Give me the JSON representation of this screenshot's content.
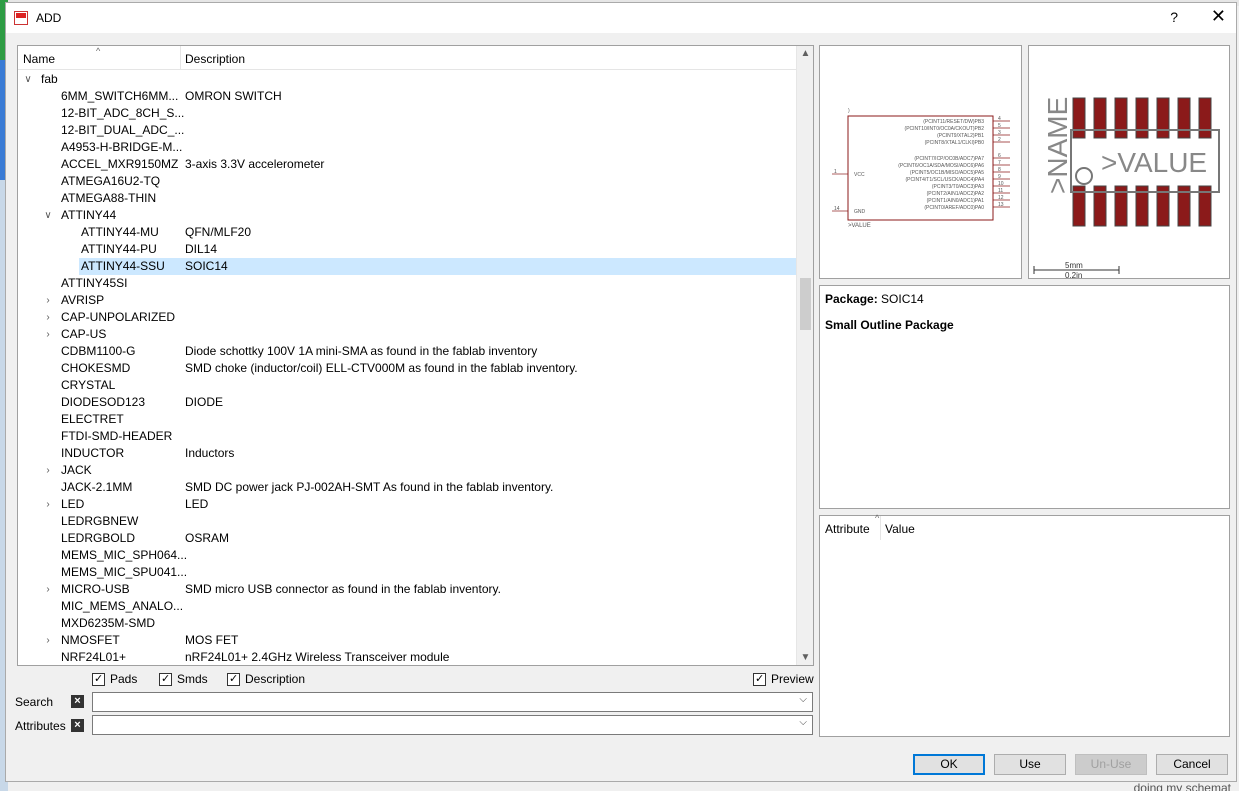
{
  "window": {
    "title": "ADD",
    "help": "?",
    "close": "✕"
  },
  "tree": {
    "col_name": "Name",
    "col_desc": "Description",
    "rows": [
      {
        "level": 0,
        "exp": "open",
        "name": "fab",
        "desc": ""
      },
      {
        "level": 1,
        "exp": "none",
        "name": "6MM_SWITCH6MM...",
        "desc": "OMRON SWITCH"
      },
      {
        "level": 1,
        "exp": "none",
        "name": "12-BIT_ADC_8CH_S...",
        "desc": ""
      },
      {
        "level": 1,
        "exp": "none",
        "name": "12-BIT_DUAL_ADC_...",
        "desc": ""
      },
      {
        "level": 1,
        "exp": "none",
        "name": "A4953-H-BRIDGE-M...",
        "desc": ""
      },
      {
        "level": 1,
        "exp": "none",
        "name": "ACCEL_MXR9150MZ",
        "desc": "3-axis 3.3V accelerometer"
      },
      {
        "level": 1,
        "exp": "none",
        "name": "ATMEGA16U2-TQ",
        "desc": ""
      },
      {
        "level": 1,
        "exp": "none",
        "name": "ATMEGA88-THIN",
        "desc": ""
      },
      {
        "level": 1,
        "exp": "open",
        "name": "ATTINY44",
        "desc": ""
      },
      {
        "level": 2,
        "exp": "none",
        "name": "ATTINY44-MU",
        "desc": "QFN/MLF20"
      },
      {
        "level": 2,
        "exp": "none",
        "name": "ATTINY44-PU",
        "desc": "DIL14"
      },
      {
        "level": 2,
        "exp": "none",
        "name": "ATTINY44-SSU",
        "desc": "SOIC14",
        "selected": true
      },
      {
        "level": 1,
        "exp": "none",
        "name": "ATTINY45SI",
        "desc": ""
      },
      {
        "level": 1,
        "exp": "closed",
        "name": "AVRISP",
        "desc": ""
      },
      {
        "level": 1,
        "exp": "closed",
        "name": "CAP-UNPOLARIZED",
        "desc": ""
      },
      {
        "level": 1,
        "exp": "closed",
        "name": "CAP-US",
        "desc": ""
      },
      {
        "level": 1,
        "exp": "none",
        "name": "CDBM1100-G",
        "desc": "Diode schottky 100V 1A mini-SMA as found in the fablab inventory"
      },
      {
        "level": 1,
        "exp": "none",
        "name": "CHOKESMD",
        "desc": "SMD choke (inductor/coil) ELL-CTV000M as found in the fablab inventory."
      },
      {
        "level": 1,
        "exp": "none",
        "name": "CRYSTAL",
        "desc": ""
      },
      {
        "level": 1,
        "exp": "none",
        "name": "DIODESOD123",
        "desc": "DIODE"
      },
      {
        "level": 1,
        "exp": "none",
        "name": "ELECTRET",
        "desc": ""
      },
      {
        "level": 1,
        "exp": "none",
        "name": "FTDI-SMD-HEADER",
        "desc": ""
      },
      {
        "level": 1,
        "exp": "none",
        "name": "INDUCTOR",
        "desc": "Inductors"
      },
      {
        "level": 1,
        "exp": "closed",
        "name": "JACK",
        "desc": ""
      },
      {
        "level": 1,
        "exp": "none",
        "name": "JACK-2.1MM",
        "desc": "SMD DC power jack PJ-002AH-SMT As found in the fablab inventory."
      },
      {
        "level": 1,
        "exp": "closed",
        "name": "LED",
        "desc": "LED"
      },
      {
        "level": 1,
        "exp": "none",
        "name": "LEDRGBNEW",
        "desc": ""
      },
      {
        "level": 1,
        "exp": "none",
        "name": "LEDRGBOLD",
        "desc": "OSRAM"
      },
      {
        "level": 1,
        "exp": "none",
        "name": "MEMS_MIC_SPH064...",
        "desc": ""
      },
      {
        "level": 1,
        "exp": "none",
        "name": "MEMS_MIC_SPU041...",
        "desc": ""
      },
      {
        "level": 1,
        "exp": "closed",
        "name": "MICRO-USB",
        "desc": "SMD micro USB connector as found in the fablab inventory."
      },
      {
        "level": 1,
        "exp": "none",
        "name": "MIC_MEMS_ANALO...",
        "desc": ""
      },
      {
        "level": 1,
        "exp": "none",
        "name": "MXD6235M-SMD",
        "desc": ""
      },
      {
        "level": 1,
        "exp": "closed",
        "name": "NMOSFET",
        "desc": "MOS FET"
      },
      {
        "level": 1,
        "exp": "none",
        "name": "NRF24L01+",
        "desc": "nRF24L01+ 2.4GHz Wireless Transceiver module"
      }
    ]
  },
  "checks": {
    "pads": "Pads",
    "smds": "Smds",
    "description": "Description",
    "preview": "Preview"
  },
  "search": {
    "label": "Search",
    "value": ""
  },
  "attributes_filter": {
    "label": "Attributes",
    "value": ""
  },
  "symbol": {
    "pins_right": [
      "(PCINT11/RESET/DW)PB3",
      "(PCINT10/INT0/OC0A/CKOUT)PB2",
      "(PCINT9/XTAL2)PB1",
      "(PCINT8/XTAL1/CLKI)PB0",
      "(PCINT7/ICP/OC0B/ADC7)PA7",
      "(PCINT6/OC1A/SDA/MOSI/ADC6)PA6",
      "(PCINT5/OC1B/MISO/ADC5)PA5",
      "(PCINT4/T1/SCL/USCK/ADC4)PA4",
      "(PCINT3/T0/ADC3)PA3",
      "(PCINT2/AIN1/ADC2)PA2",
      "(PCINT1/AIN0/ADC1)PA1",
      "(PCINT0/AREF/ADC0)PA0"
    ],
    "pin_numbers": [
      "4",
      "5",
      "3",
      "2",
      "6",
      "7",
      "8",
      "9",
      "10",
      "11",
      "12",
      "13"
    ],
    "vcc": "VCC",
    "vcc_num": "1",
    "gnd": "GND",
    "gnd_num": "14",
    "value": ">VALUE"
  },
  "package": {
    "name_label": ">NAME",
    "value_label": ">VALUE",
    "scale_top": "5mm",
    "scale_bottom": "0.2in",
    "pad_color": "#8b1a1a"
  },
  "info": {
    "package_label": "Package:",
    "package_value": "SOIC14",
    "package_desc": "Small Outline Package"
  },
  "attr_table": {
    "col_attribute": "Attribute",
    "col_value": "Value"
  },
  "buttons": {
    "ok": "OK",
    "use": "Use",
    "unuse": "Un-Use",
    "cancel": "Cancel"
  },
  "background": {
    "note": "doing my schemat"
  }
}
